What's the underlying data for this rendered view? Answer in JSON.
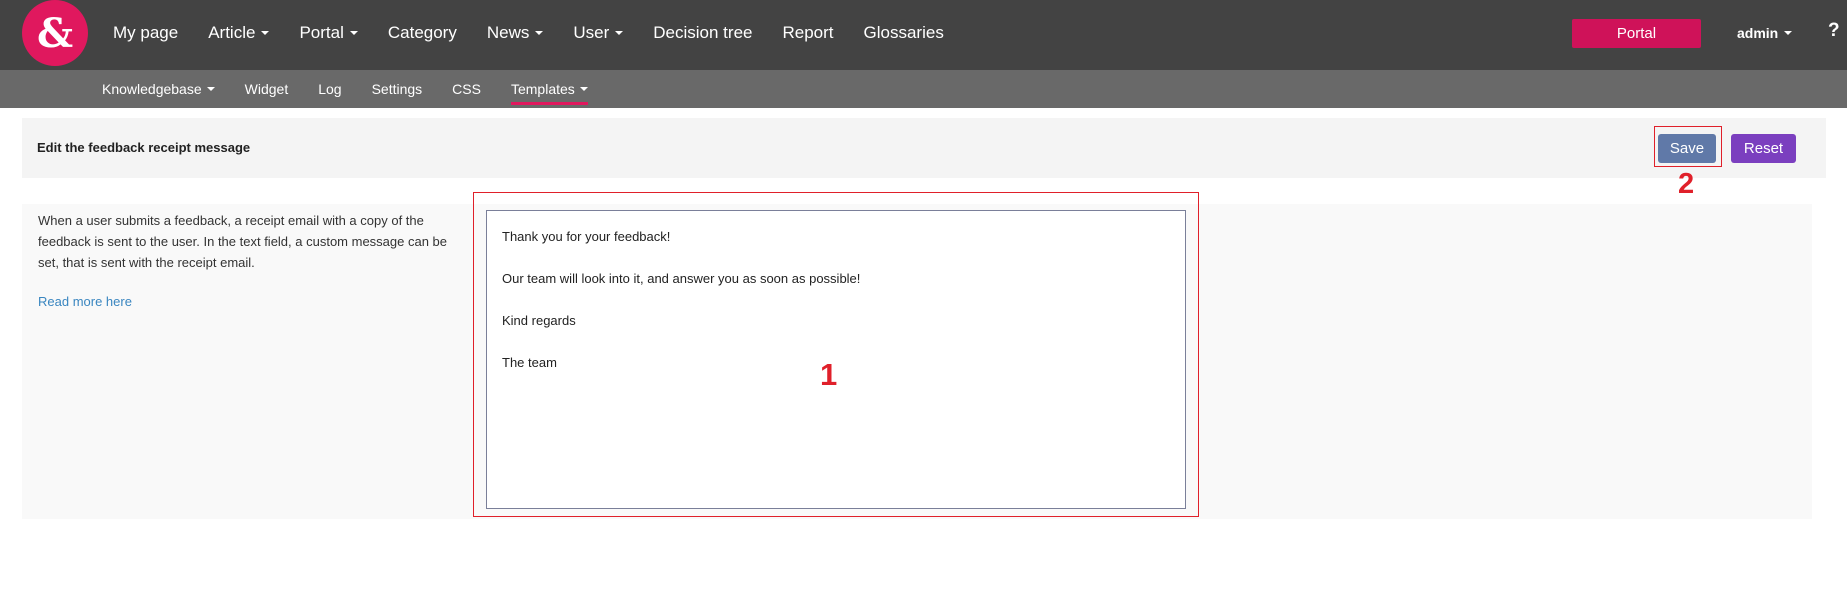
{
  "brand": {
    "logo_glyph": "&",
    "logo_color": "#e0185e"
  },
  "topnav": {
    "items": [
      {
        "label": "My page",
        "dropdown": false
      },
      {
        "label": "Article",
        "dropdown": true
      },
      {
        "label": "Portal",
        "dropdown": true
      },
      {
        "label": "Category",
        "dropdown": false
      },
      {
        "label": "News",
        "dropdown": true
      },
      {
        "label": "User",
        "dropdown": true
      },
      {
        "label": "Decision tree",
        "dropdown": false
      },
      {
        "label": "Report",
        "dropdown": false
      },
      {
        "label": "Glossaries",
        "dropdown": false
      }
    ],
    "portal_button": "Portal",
    "user_menu": "admin",
    "help_glyph": "?"
  },
  "subnav": {
    "items": [
      {
        "label": "Knowledgebase",
        "dropdown": true,
        "active": false
      },
      {
        "label": "Widget",
        "dropdown": false,
        "active": false
      },
      {
        "label": "Log",
        "dropdown": false,
        "active": false
      },
      {
        "label": "Settings",
        "dropdown": false,
        "active": false
      },
      {
        "label": "CSS",
        "dropdown": false,
        "active": false
      },
      {
        "label": "Templates",
        "dropdown": true,
        "active": true
      }
    ]
  },
  "editor_page": {
    "title": "Edit the feedback receipt message",
    "save_label": "Save",
    "reset_label": "Reset",
    "description": "When a user submits a feedback, a receipt email with a copy of the feedback is sent to the user. In the text field, a custom message can be set, that is sent with the receipt email.",
    "read_more": "Read more here",
    "message_lines": [
      "Thank you for your feedback!",
      "Our team will look into it, and answer you as soon as possible!",
      "Kind regards",
      "The team"
    ]
  },
  "annotations": {
    "marker_1": "1",
    "marker_2": "2",
    "highlight_color": "#e0202a"
  },
  "colors": {
    "topbar": "#434343",
    "subbar": "#696969",
    "portal_button": "#cf1259",
    "save_button": "#6079a8",
    "reset_button": "#7b3fbf",
    "link": "#3a86c0"
  }
}
